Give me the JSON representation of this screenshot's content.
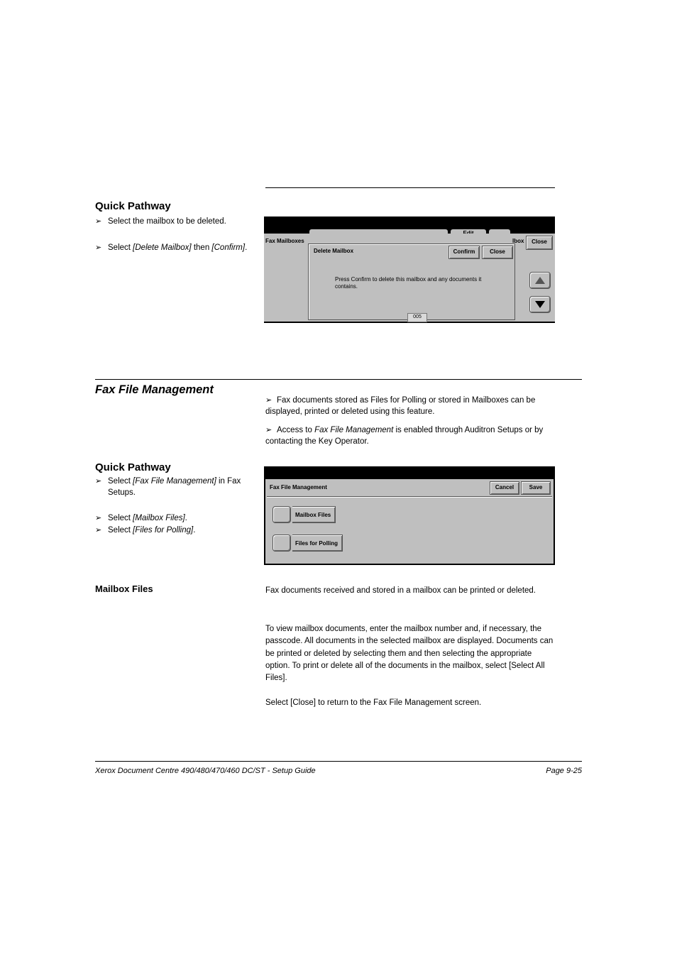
{
  "block1": {
    "heading": "Quick Pathway",
    "bullet1_a": "Select the mailbox to be deleted.",
    "bullet2_a": "Select ",
    "bullet2_b": "[Delete Mailbox]",
    "bullet2_c": " then ",
    "bullet2_d": "[Confirm]",
    "bullet2_e": "."
  },
  "shot1": {
    "tab_edit": "Edit",
    "fax_mailboxes": "Fax Mailboxes",
    "box_suffix": "lbox",
    "top_close": "Close",
    "title": "Delete Mailbox",
    "confirm": "Confirm",
    "close": "Close",
    "msg": "Press Confirm to delete this mailbox and any documents it contains.",
    "rownum": "005"
  },
  "section2": {
    "title": "Fax File Management",
    "p1": "Fax documents stored as Files for Polling or stored in Mailboxes can be displayed, printed or deleted using this feature.",
    "p2_a": "Access to ",
    "p2_b": "Fax File Management",
    "p2_c": " is enabled through Auditron Setups or by contacting the Key Operator."
  },
  "quick": {
    "heading": "Quick Pathway",
    "b1_a": "Select ",
    "b1_b": "[Fax File Management]",
    "b1_c": " in Fax Setups.",
    "b2_a": "Select ",
    "b2_b": "[Mailbox Files]",
    "b2_c": ".",
    "b3_a": "Select ",
    "b3_b": "[Files for Polling]",
    "b3_c": "."
  },
  "shot2": {
    "title": "Fax File Management",
    "cancel": "Cancel",
    "save": "Save",
    "opt1": "Mailbox Files",
    "opt2": "Files for Polling"
  },
  "mf": {
    "title": "Mailbox Files",
    "p1": "Fax documents received and stored in a mailbox can be printed or deleted.",
    "p2": "To view mailbox documents, enter the mailbox number and, if necessary, the passcode. All documents in the selected mailbox are displayed. Documents can be printed or deleted by selecting them and then selecting the appropriate option. To print or delete all of the documents in the mailbox, select [Select All Files].",
    "p3": "Select [Close] to return to the Fax File Management screen."
  },
  "footer": {
    "left": "Xerox Document Centre 490/480/470/460 DC/ST - Setup Guide",
    "right": "Page 9-25"
  }
}
